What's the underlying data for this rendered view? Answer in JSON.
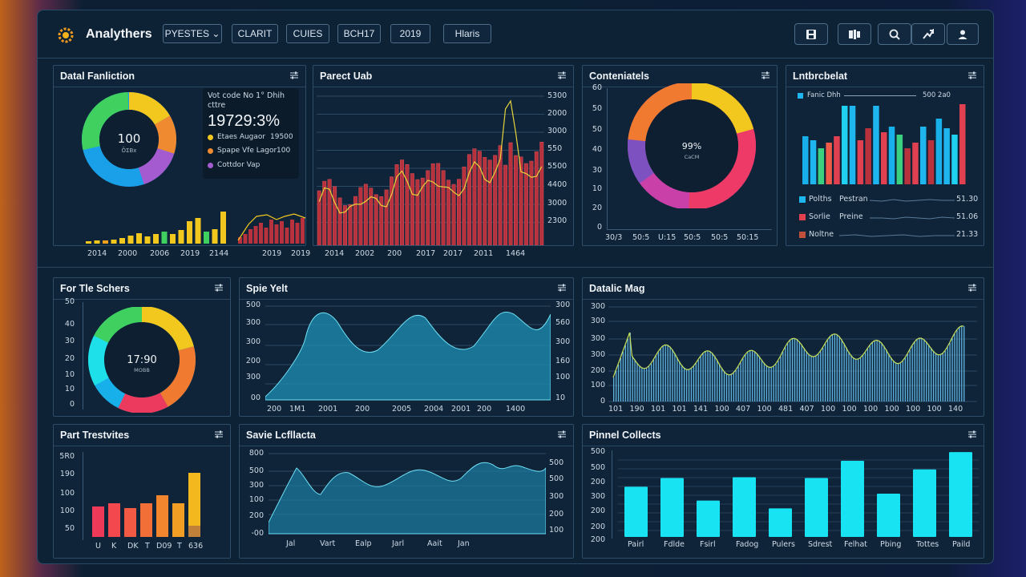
{
  "app": {
    "title": "Analythers"
  },
  "toolbar": {
    "buttons": [
      "PYESTES ⌄",
      "CLARIT",
      "CUIES",
      "BCH17",
      "2019",
      "Hlaris"
    ]
  },
  "icons": [
    "save-icon",
    "gallery-icon",
    "search-icon",
    "share-icon",
    "user-icon"
  ],
  "colors": {
    "accent": "#2ed3f0",
    "bar_red": "#b8323d",
    "bar_yellow": "#f2c81e",
    "cyan": "#18e3f2",
    "panel_bg": "#0f2439",
    "border": "#2e4d68"
  },
  "panels": {
    "p1": {
      "title": "Datal Fanliction",
      "donut_value": "100",
      "donut_sub": "ŌΣВх",
      "tooltip_head": "Vot code No 1° Dhih",
      "tooltip_sub": "cttre",
      "tooltip_big": "19729:3%",
      "legend": [
        {
          "label": "Etaes Augaor",
          "value": "19500",
          "color": "#f2c81e"
        },
        {
          "label": "Spape Vfe Lagor",
          "value": "100",
          "color": "#f08a30"
        },
        {
          "label": "Cottdor Vap",
          "value": "",
          "color": "#a55bd0"
        }
      ],
      "x_labels": [
        "2014",
        "2000",
        "2006",
        "2019",
        "2144",
        "2019",
        "2019"
      ]
    },
    "p2": {
      "title": "Parect Uab",
      "y_labels": [
        "5300",
        "2000",
        "3000",
        "550",
        "5500",
        "4400",
        "3000",
        "2300"
      ],
      "x_labels": [
        "2014",
        "2002",
        "200",
        "2017",
        "2017",
        "2011",
        "1464"
      ]
    },
    "p3": {
      "title": "Conteniatels",
      "donut_value": "99%",
      "donut_sub": "СаСМ",
      "y_labels": [
        "60",
        "50",
        "50",
        "40",
        "30",
        "10",
        "20",
        "0"
      ],
      "x_labels": [
        "30/3",
        "50:5",
        "U:15",
        "50:5",
        "50:5",
        "50:15"
      ]
    },
    "p4": {
      "title": "Lntbrcbelat",
      "legend_top": "Fanic Dhh",
      "legend_top_val": "500 2a0",
      "rows": [
        {
          "label": "Polths",
          "sub": "Pestran",
          "value": "51.30",
          "color": "#1fb6ef"
        },
        {
          "label": "Sorlie",
          "sub": "Preine",
          "value": "51.06",
          "color": "#e04050"
        },
        {
          "label": "Noltne",
          "sub": "",
          "value": "21.33",
          "color": "#c0503c"
        }
      ]
    },
    "p5": {
      "title": "For Tle Schers",
      "donut_value": "17:90",
      "donut_sub": "МОВВ",
      "y_labels": [
        "50",
        "40",
        "30",
        "20",
        "10",
        "10",
        "0"
      ]
    },
    "p6": {
      "title": "Spie Yelt",
      "y_left": [
        "500",
        "300",
        "300",
        "200",
        "300",
        "00"
      ],
      "y_right": [
        "300",
        "560",
        "300",
        "160",
        "100",
        "10"
      ],
      "x_labels": [
        "200",
        "1M1",
        "2001",
        "200",
        "2005",
        "2004",
        "2001",
        "200",
        "1400"
      ]
    },
    "p7": {
      "title": "Datalic Mag",
      "y_labels": [
        "300",
        "300",
        "300",
        "300",
        "200",
        "100",
        "0"
      ],
      "x_labels": [
        "101",
        "190",
        "101",
        "101",
        "141",
        "100",
        "407",
        "100",
        "481",
        "407",
        "100",
        "100",
        "100",
        "100",
        "100",
        "100",
        "140"
      ]
    },
    "p8": {
      "title": "Part Trestvites",
      "y_labels": [
        "5R0",
        "190",
        "100",
        "100",
        "50"
      ],
      "x_labels": [
        "U",
        "K",
        "DK",
        "T",
        "D09",
        "T",
        "636"
      ]
    },
    "p9": {
      "title": "Savie Lcfllacta",
      "y_left": [
        "800",
        "500",
        "300",
        "100",
        "200",
        "-00"
      ],
      "y_right": [
        "500",
        "500",
        "300",
        "200",
        "100"
      ],
      "x_labels": [
        "Jal",
        "Vart",
        "Ealp",
        "Jarl",
        "Aait",
        "Jan"
      ]
    },
    "p10": {
      "title": "Pinnel Collects",
      "y_labels": [
        "500",
        "500",
        "200",
        "300",
        "200",
        "200",
        "200"
      ],
      "categories": [
        "Pairl",
        "Fdlde",
        "Fsirl",
        "Fadog",
        "Pulers",
        "Sdrest",
        "Felhat",
        "Pbing",
        "Tottes",
        "Paild"
      ],
      "values": [
        58,
        68,
        42,
        69,
        33,
        68,
        88,
        50,
        78,
        98
      ]
    }
  }
}
